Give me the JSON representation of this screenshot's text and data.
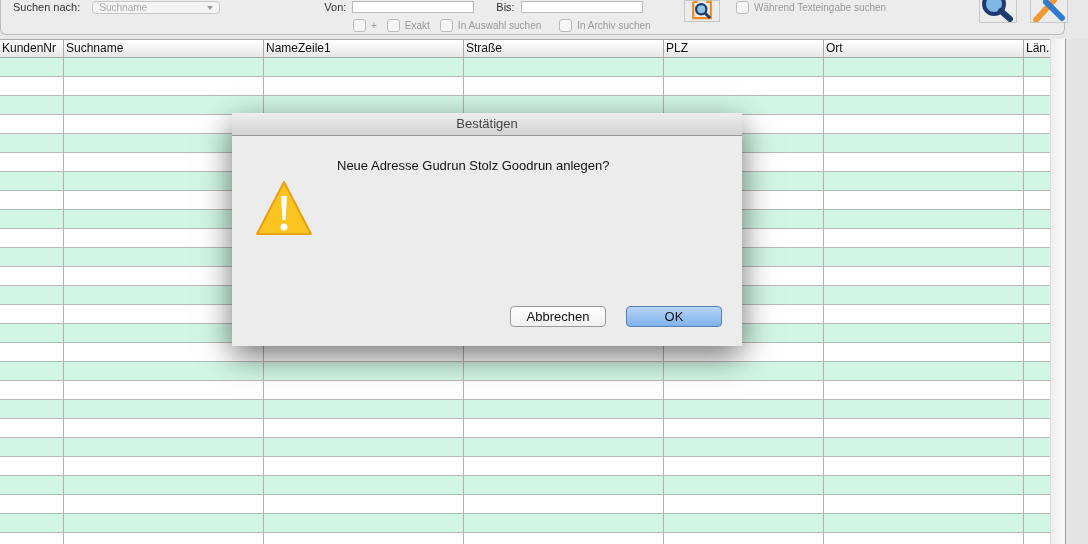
{
  "search_panel": {
    "search_by_label": "Suchen nach:",
    "search_by_value": "Suchname",
    "from_label": "Von:",
    "to_label": "Bis:",
    "options": [
      {
        "label": "+",
        "checked": false
      },
      {
        "label": "Exakt",
        "checked": false
      },
      {
        "label": "In Auswahl suchen",
        "checked": false
      },
      {
        "label": "In Archiv suchen",
        "checked": false
      }
    ],
    "live_search": {
      "label": "Während Texteingabe suchen",
      "checked": false
    }
  },
  "table": {
    "columns": [
      "KundenNr",
      "Suchname",
      "NameZeile1",
      "Straße",
      "PLZ",
      "Ort",
      "Län."
    ]
  },
  "dialog": {
    "title": "Bestätigen",
    "message": "Neue Adresse Gudrun Stolz Goodrun anlegen?",
    "buttons": [
      {
        "label": "Abbrechen",
        "default": false
      },
      {
        "label": "OK",
        "default": true
      }
    ]
  }
}
